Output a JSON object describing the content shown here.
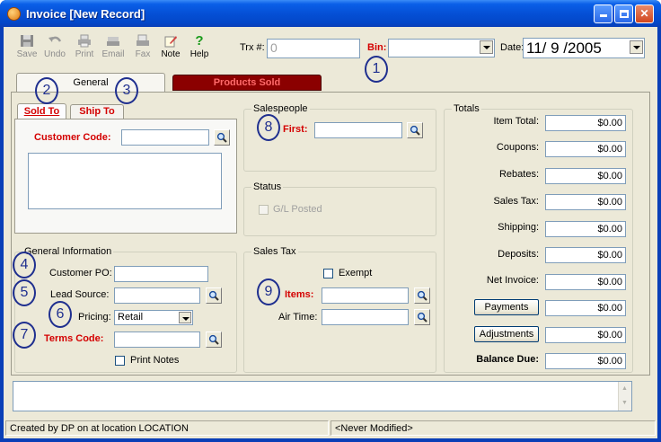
{
  "window": {
    "title": "Invoice [New Record]"
  },
  "toolbar": {
    "save": "Save",
    "undo": "Undo",
    "print": "Print",
    "email": "Email",
    "fax": "Fax",
    "note": "Note",
    "help": "Help"
  },
  "header": {
    "trx_label": "Trx #:",
    "trx_value": "0",
    "bin_label": "Bin:",
    "bin_value": "",
    "date_label": "Date:",
    "date_value": "11/ 9 /2005"
  },
  "tabs": {
    "general": "General",
    "products_sold": "Products Sold"
  },
  "subtabs": {
    "sold_to": "Sold To",
    "ship_to": "Ship To"
  },
  "sold_to": {
    "customer_code_label": "Customer Code:",
    "customer_code_value": ""
  },
  "general_info": {
    "title": "General Information",
    "customer_po_label": "Customer PO:",
    "customer_po_value": "",
    "lead_source_label": "Lead Source:",
    "lead_source_value": "",
    "pricing_label": "Pricing:",
    "pricing_value": "Retail",
    "terms_code_label": "Terms Code:",
    "terms_code_value": "",
    "print_notes_label": "Print Notes"
  },
  "salespeople": {
    "title": "Salespeople",
    "first_label": "First:",
    "first_value": ""
  },
  "status": {
    "title": "Status",
    "gl_posted_label": "G/L Posted"
  },
  "sales_tax": {
    "title": "Sales Tax",
    "exempt_label": "Exempt",
    "items_label": "Items:",
    "items_value": "",
    "air_time_label": "Air Time:",
    "air_time_value": ""
  },
  "totals": {
    "title": "Totals",
    "rows": [
      {
        "label": "Item Total:",
        "value": "$0.00"
      },
      {
        "label": "Coupons:",
        "value": "$0.00"
      },
      {
        "label": "Rebates:",
        "value": "$0.00"
      },
      {
        "label": "Sales Tax:",
        "value": "$0.00"
      },
      {
        "label": "Shipping:",
        "value": "$0.00"
      },
      {
        "label": "Deposits:",
        "value": "$0.00"
      },
      {
        "label": "Net Invoice:",
        "value": "$0.00"
      }
    ],
    "payments_button": "Payments",
    "payments_value": "$0.00",
    "adjustments_button": "Adjustments",
    "adjustments_value": "$0.00",
    "balance_due_label": "Balance Due:",
    "balance_due_value": "$0.00"
  },
  "markers": [
    "1",
    "2",
    "3",
    "4",
    "5",
    "6",
    "7",
    "8",
    "9"
  ],
  "statusbar": {
    "created": "Created by DP on  at location LOCATION",
    "modified": "<Never Modified>"
  },
  "colors": {
    "accent_red": "#d40000",
    "products_tab": "#8b0000",
    "marker_blue": "#1f2f8f",
    "face": "#ece9d8"
  },
  "icons": [
    "app-icon",
    "save-icon",
    "undo-icon",
    "print-icon",
    "email-icon",
    "fax-icon",
    "note-icon",
    "help-icon",
    "magnifier-icon",
    "minimize-icon",
    "maximize-icon",
    "close-icon",
    "dropdown-arrow-icon"
  ]
}
